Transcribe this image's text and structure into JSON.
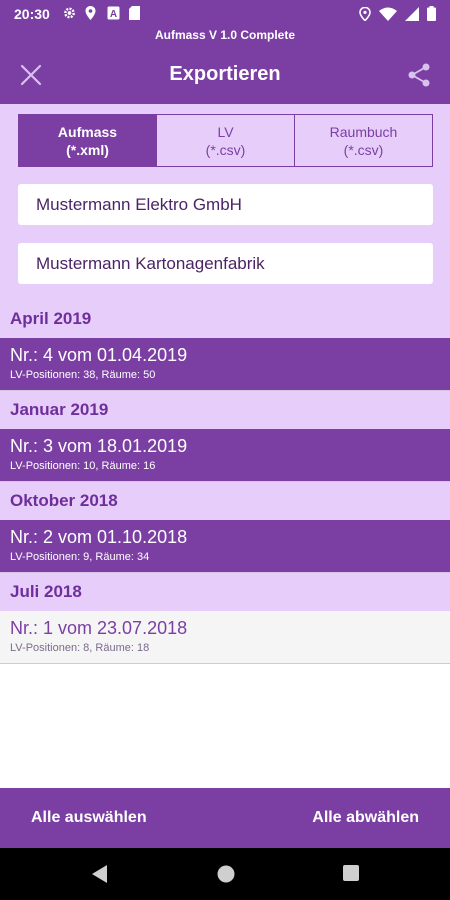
{
  "status_bar": {
    "time": "20:30",
    "left_icons": [
      "gear-icon",
      "location-pin-icon",
      "font-app-icon",
      "sd-card-icon"
    ],
    "right_icons": [
      "location-icon",
      "wifi-icon",
      "cellular-signal-icon",
      "battery-icon"
    ]
  },
  "app_subtitle": "Aufmass V 1.0 Complete",
  "toolbar": {
    "title": "Exportieren",
    "close_icon": "close-icon",
    "share_icon": "share-icon"
  },
  "export_formats": [
    {
      "line1": "Aufmass",
      "line2": "(*.xml)",
      "active": true
    },
    {
      "line1": "LV",
      "line2": "(*.csv)",
      "active": false
    },
    {
      "line1": "Raumbuch",
      "line2": "(*.csv)",
      "active": false
    }
  ],
  "fields": {
    "company": "Mustermann Elektro GmbH",
    "client": "Mustermann Kartonagenfabrik"
  },
  "groups": [
    {
      "month": "April 2019",
      "entry": {
        "title": "Nr.: 4 vom 01.04.2019",
        "details": "LV-Positionen: 38, Räume: 50",
        "selected": true
      }
    },
    {
      "month": "Januar 2019",
      "entry": {
        "title": "Nr.: 3 vom 18.01.2019",
        "details": "LV-Positionen: 10, Räume: 16",
        "selected": true
      }
    },
    {
      "month": "Oktober 2018",
      "entry": {
        "title": "Nr.: 2 vom 01.10.2018",
        "details": "LV-Positionen: 9, Räume: 34",
        "selected": true
      }
    },
    {
      "month": "Juli 2018",
      "entry": {
        "title": "Nr.: 1 vom 23.07.2018",
        "details": "LV-Positionen: 8, Räume: 18",
        "selected": false
      }
    }
  ],
  "bottom_bar": {
    "select_all": "Alle auswählen",
    "deselect_all": "Alle abwählen"
  },
  "nav_bar": [
    "back-icon",
    "home-icon",
    "recents-icon"
  ],
  "colors": {
    "primary": "#7b3fa4",
    "light_section": "#e7cdfa",
    "list_background": "#f5f5f5"
  }
}
